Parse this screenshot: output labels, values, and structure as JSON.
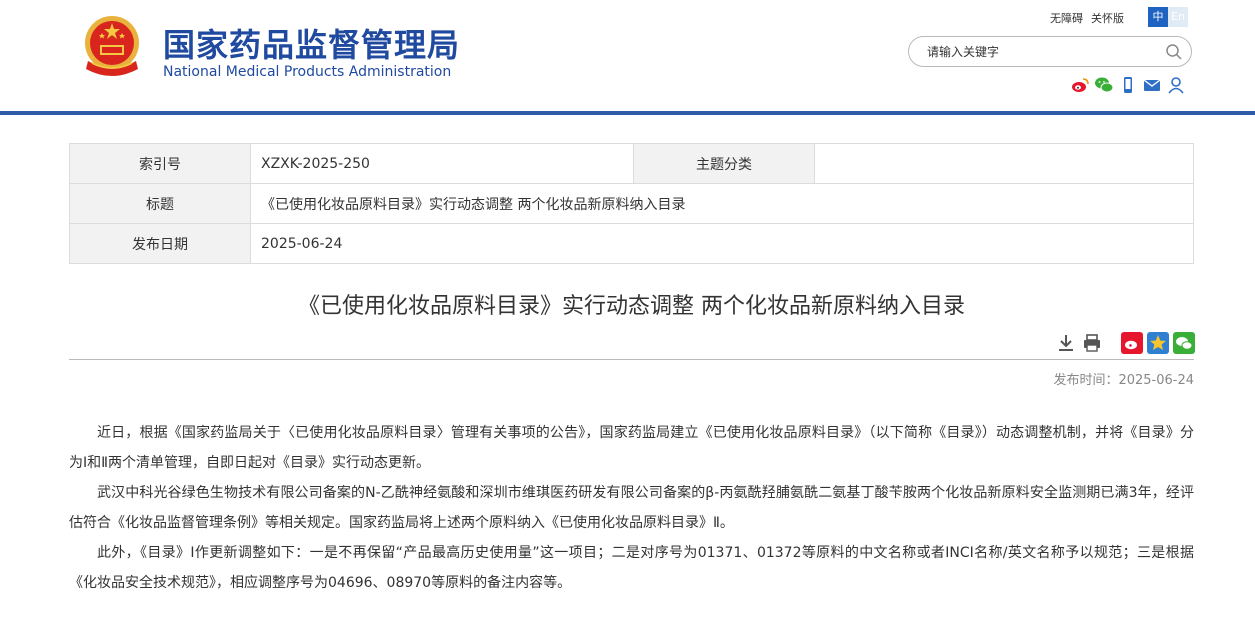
{
  "header": {
    "logo_cn": "国家药品监督管理局",
    "logo_en": "National Medical Products Administration",
    "links": {
      "accessibility": "无障碍",
      "elder": "关怀版"
    },
    "lang": {
      "zh": "中",
      "en": "En"
    },
    "search": {
      "placeholder": "请输入关键字"
    },
    "social_icons": [
      "weibo-icon",
      "wechat-icon",
      "mobile-icon",
      "mail-icon",
      "user-icon"
    ]
  },
  "meta": {
    "index_label": "索引号",
    "index_value": "XZXK-2025-250",
    "topic_label": "主题分类",
    "topic_value": "",
    "title_label": "标题",
    "title_value": "《已使用化妆品原料目录》实行动态调整 两个化妆品新原料纳入目录",
    "date_label": "发布日期",
    "date_value": "2025-06-24"
  },
  "article": {
    "title": "《已使用化妆品原料目录》实行动态调整 两个化妆品新原料纳入目录",
    "pub_time": "发布时间：2025-06-24",
    "paragraphs": [
      "近日，根据《国家药监局关于〈已使用化妆品原料目录〉管理有关事项的公告》，国家药监局建立《已使用化妆品原料目录》（以下简称《目录》）动态调整机制，并将《目录》分为Ⅰ和Ⅱ两个清单管理，自即日起对《目录》实行动态更新。",
      "武汉中科光谷绿色生物技术有限公司备案的N-乙酰神经氨酸和深圳市维琪医药研发有限公司备案的β-丙氨酰羟脯氨酰二氨基丁酸苄胺两个化妆品新原料安全监测期已满3年，经评估符合《化妆品监督管理条例》等相关规定。国家药监局将上述两个原料纳入《已使用化妆品原料目录》Ⅱ。",
      "此外，《目录》Ⅰ作更新调整如下：一是不再保留“产品最高历史使用量”这一项目；二是对序号为01371、01372等原料的中文名称或者INCI名称/英文名称予以规范；三是根据《化妆品安全技术规范》，相应调整序号为04696、08970等原料的备注内容等。"
    ]
  },
  "colors": {
    "brand": "#1f4aa0",
    "header_bar": "#2f5aa8",
    "lang_active": "#1e63c2"
  }
}
